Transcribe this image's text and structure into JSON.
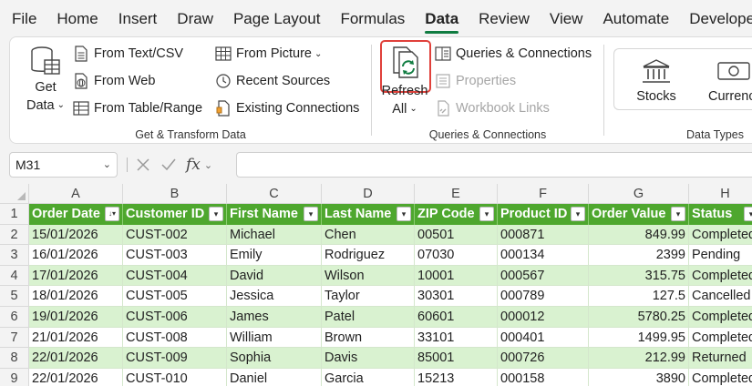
{
  "menu": [
    "File",
    "Home",
    "Insert",
    "Draw",
    "Page Layout",
    "Formulas",
    "Data",
    "Review",
    "View",
    "Automate",
    "Developer"
  ],
  "active_tab": "Data",
  "ribbon": {
    "get_transform": {
      "get_data_line1": "Get",
      "get_data_line2": "Data",
      "from_text_csv": "From Text/CSV",
      "from_web": "From Web",
      "from_table_range": "From Table/Range",
      "from_picture": "From Picture",
      "recent_sources": "Recent Sources",
      "existing_connections": "Existing Connections",
      "label": "Get & Transform Data"
    },
    "queries": {
      "refresh_line1": "Refresh",
      "refresh_line2": "All",
      "queries_connections": "Queries & Connections",
      "properties": "Properties",
      "workbook_links": "Workbook Links",
      "label": "Queries & Connections"
    },
    "data_types": {
      "stocks": "Stocks",
      "currencies": "Currencies",
      "label": "Data Types"
    },
    "highlight_color": "#e0413b",
    "accent_color": "#107c41"
  },
  "formula_bar": {
    "name_box": "M31",
    "fx": "fx",
    "content": ""
  },
  "sheet": {
    "columns": [
      "A",
      "B",
      "C",
      "D",
      "E",
      "F",
      "G",
      "H"
    ],
    "header_color": "#4ea72e",
    "band_color": "#d9f2d0",
    "headers": [
      "Order Date",
      "Customer ID",
      "First Name",
      "Last Name",
      "ZIP Code",
      "Product ID",
      "Order Value",
      "Status"
    ],
    "rows": [
      {
        "n": "2",
        "cells": [
          "15/01/2026",
          "CUST-002",
          "Michael",
          "Chen",
          "00501",
          "000871",
          "849.99",
          "Completed"
        ]
      },
      {
        "n": "3",
        "cells": [
          "16/01/2026",
          "CUST-003",
          "Emily",
          "Rodriguez",
          "07030",
          "000134",
          "2399",
          "Pending"
        ]
      },
      {
        "n": "4",
        "cells": [
          "17/01/2026",
          "CUST-004",
          "David",
          "Wilson",
          "10001",
          "000567",
          "315.75",
          "Completed"
        ]
      },
      {
        "n": "5",
        "cells": [
          "18/01/2026",
          "CUST-005",
          "Jessica",
          "Taylor",
          "30301",
          "000789",
          "127.5",
          "Cancelled"
        ]
      },
      {
        "n": "6",
        "cells": [
          "19/01/2026",
          "CUST-006",
          "James",
          "Patel",
          "60601",
          "000012",
          "5780.25",
          "Completed"
        ]
      },
      {
        "n": "7",
        "cells": [
          "21/01/2026",
          "CUST-008",
          "William",
          "Brown",
          "33101",
          "000401",
          "1499.95",
          "Completed"
        ]
      },
      {
        "n": "8",
        "cells": [
          "22/01/2026",
          "CUST-009",
          "Sophia",
          "Davis",
          "85001",
          "000726",
          "212.99",
          "Returned"
        ]
      },
      {
        "n": "9",
        "cells": [
          "22/01/2026",
          "CUST-010",
          "Daniel",
          "Garcia",
          "15213",
          "000158",
          "3890",
          "Completed"
        ]
      }
    ]
  }
}
